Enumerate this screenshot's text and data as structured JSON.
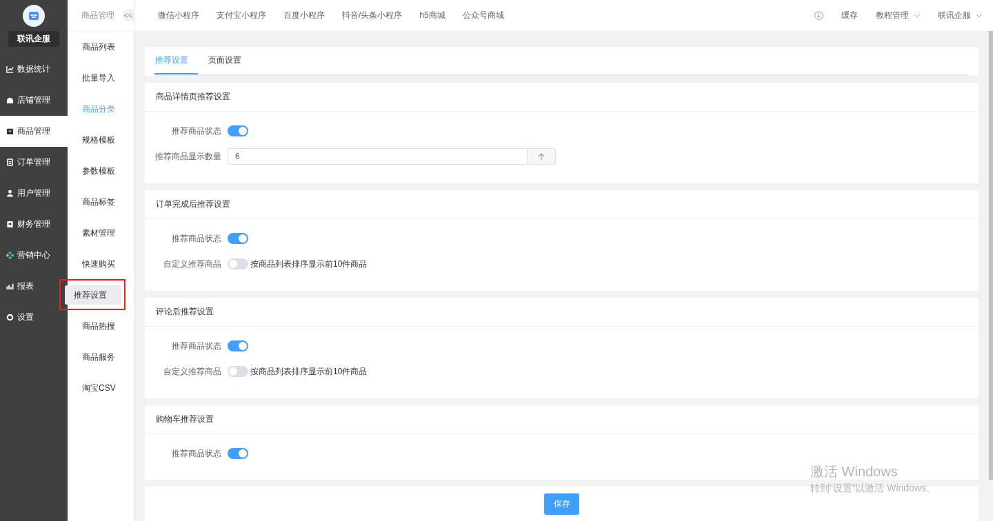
{
  "sidebar": {
    "brand": "联讯企服",
    "items": [
      {
        "label": "数据统计",
        "selected": false
      },
      {
        "label": "店铺管理",
        "selected": false
      },
      {
        "label": "商品管理",
        "selected": true
      },
      {
        "label": "订单管理",
        "selected": false
      },
      {
        "label": "用户管理",
        "selected": false
      },
      {
        "label": "财务管理",
        "selected": false
      },
      {
        "label": "营销中心",
        "selected": false
      },
      {
        "label": "报表",
        "selected": false
      },
      {
        "label": "设置",
        "selected": false
      }
    ]
  },
  "sub_nav": {
    "title": "商品管理",
    "collapse": "<<",
    "items": [
      {
        "label": "商品列表",
        "selected": false,
        "hovered": false,
        "outlined": false
      },
      {
        "label": "批量导入",
        "selected": false,
        "hovered": false,
        "outlined": false
      },
      {
        "label": "商品分类",
        "selected": false,
        "hovered": true,
        "outlined": false
      },
      {
        "label": "规格模板",
        "selected": false,
        "hovered": false,
        "outlined": false
      },
      {
        "label": "参数模板",
        "selected": false,
        "hovered": false,
        "outlined": false
      },
      {
        "label": "商品标签",
        "selected": false,
        "hovered": false,
        "outlined": false
      },
      {
        "label": "素材管理",
        "selected": false,
        "hovered": false,
        "outlined": false
      },
      {
        "label": "快速购买",
        "selected": false,
        "hovered": false,
        "outlined": false
      },
      {
        "label": "推荐设置",
        "selected": true,
        "hovered": false,
        "outlined": true
      },
      {
        "label": "商品热搜",
        "selected": false,
        "hovered": false,
        "outlined": false
      },
      {
        "label": "商品服务",
        "selected": false,
        "hovered": false,
        "outlined": false
      },
      {
        "label": "淘宝CSV",
        "selected": false,
        "hovered": false,
        "outlined": false
      }
    ]
  },
  "top_bar": {
    "links": [
      "微信小程序",
      "支付宝小程序",
      "百度小程序",
      "抖音/头条小程序",
      "h5商城",
      "公众号商城"
    ],
    "cache": "缓存",
    "menus": [
      "教程管理",
      "联讯企服"
    ]
  },
  "page_tabs": [
    {
      "label": "推荐设置",
      "selected": true
    },
    {
      "label": "页面设置",
      "selected": false
    }
  ],
  "sections": [
    {
      "title": "商品详情页推荐设置",
      "rows": [
        {
          "kind": "toggle",
          "label": "推荐商品状态",
          "on": true
        },
        {
          "kind": "number",
          "label": "推荐商品显示数量",
          "value": "6"
        }
      ]
    },
    {
      "title": "订单完成后推荐设置",
      "rows": [
        {
          "kind": "toggle",
          "label": "推荐商品状态",
          "on": true
        },
        {
          "kind": "toggle",
          "label": "自定义推荐商品",
          "on": false,
          "hint": "按商品列表排序显示前10件商品"
        }
      ]
    },
    {
      "title": "评论后推荐设置",
      "rows": [
        {
          "kind": "toggle",
          "label": "推荐商品状态",
          "on": true
        },
        {
          "kind": "toggle",
          "label": "自定义推荐商品",
          "on": false,
          "hint": "按商品列表排序显示前10件商品"
        }
      ]
    },
    {
      "title": "购物车推荐设置",
      "rows": [
        {
          "kind": "toggle",
          "label": "推荐商品状态",
          "on": true
        }
      ]
    }
  ],
  "save_button": "保存",
  "activation_notice": {
    "title": "激活 Windows",
    "text": "转到“设置”以激活 Windows。"
  }
}
